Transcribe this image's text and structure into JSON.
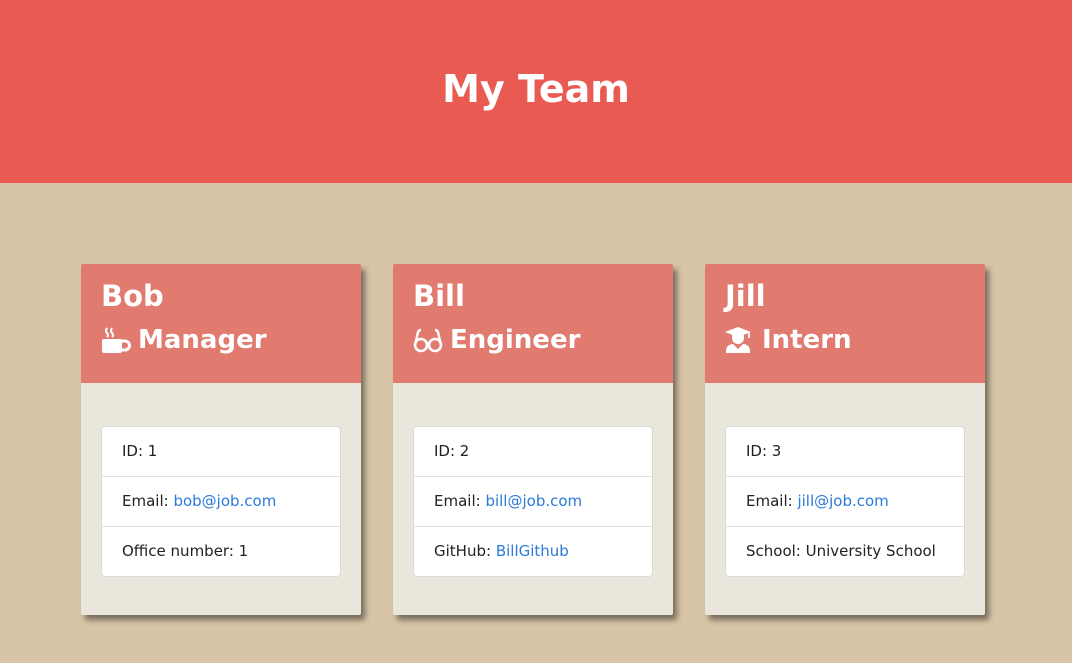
{
  "header": {
    "title": "My Team"
  },
  "colors": {
    "header_bg": "#e85a52",
    "card_head_bg": "#e17b70",
    "page_bg": "#d8c4a6",
    "link": "#2a7ad9"
  },
  "employees": [
    {
      "name": "Bob",
      "role": "Manager",
      "role_icon": "mug-icon",
      "id_label": "ID: 1",
      "email_label": "Email: ",
      "email": "bob@job.com",
      "extra_label": "Office number: 1",
      "extra_link": ""
    },
    {
      "name": "Bill",
      "role": "Engineer",
      "role_icon": "glasses-icon",
      "id_label": "ID: 2",
      "email_label": "Email: ",
      "email": "bill@job.com",
      "extra_label": "GitHub: ",
      "extra_link": "BillGithub"
    },
    {
      "name": "Jill",
      "role": "Intern",
      "role_icon": "graduate-icon",
      "id_label": "ID: 3",
      "email_label": "Email: ",
      "email": "jill@job.com",
      "extra_label": "School: University School",
      "extra_link": ""
    }
  ]
}
